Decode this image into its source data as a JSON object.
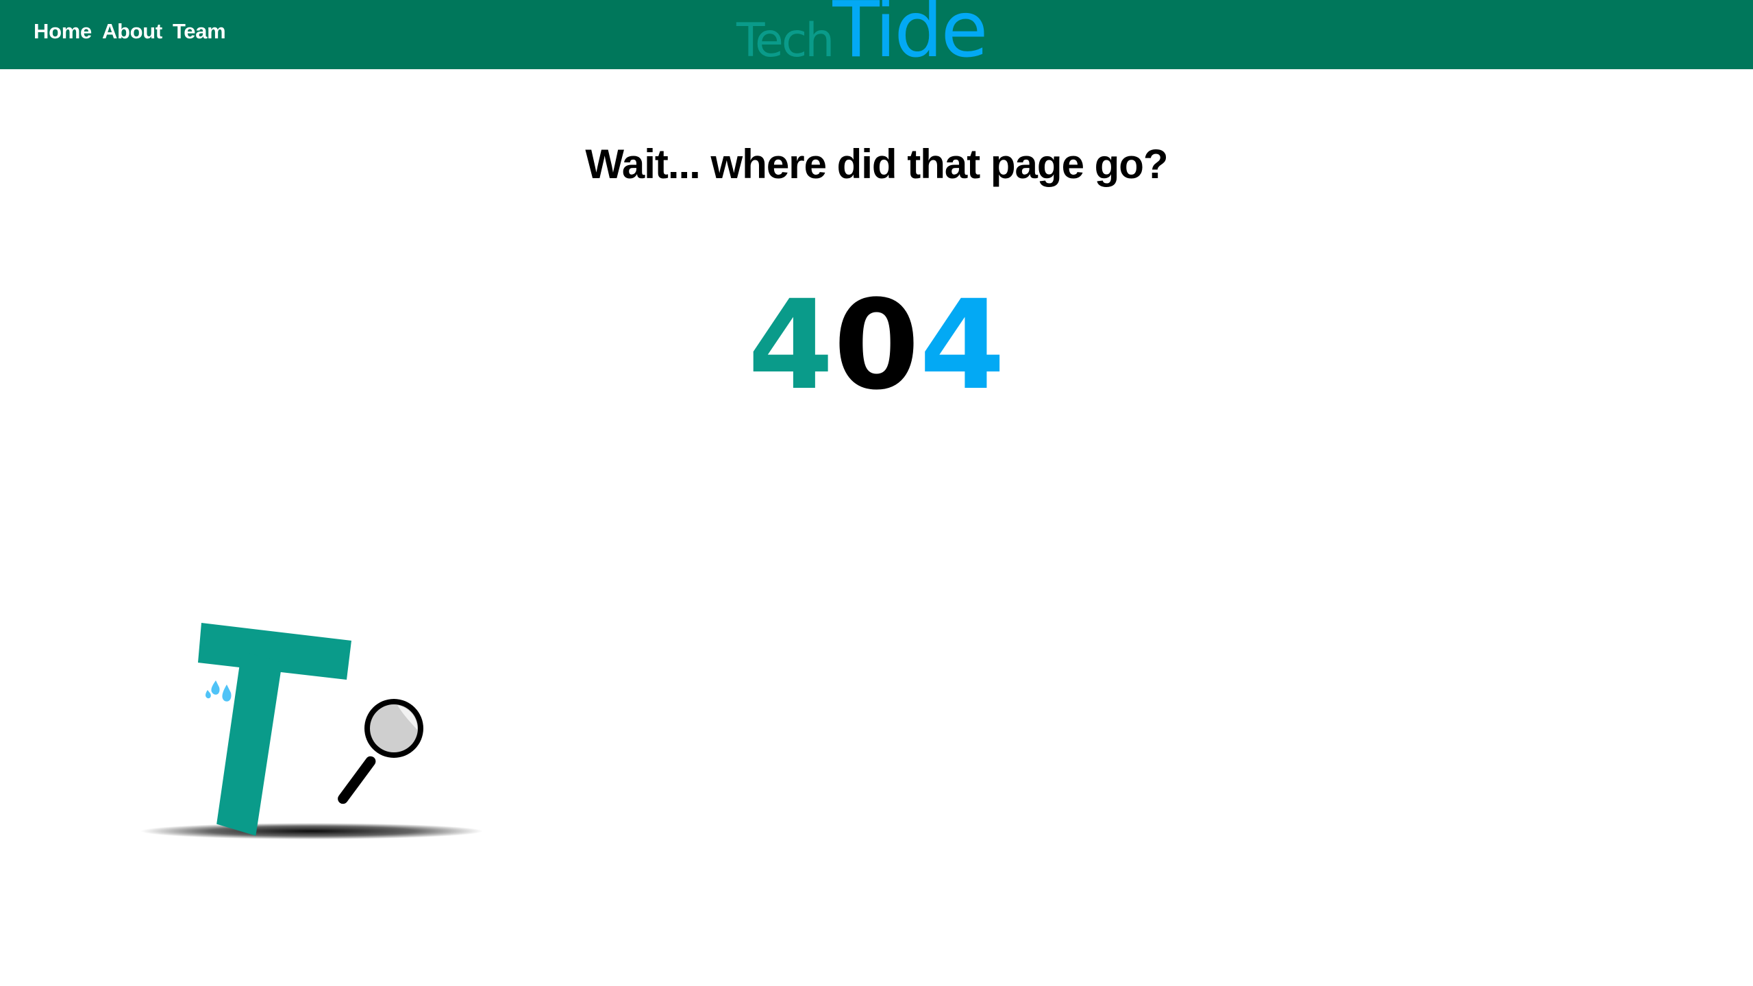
{
  "nav": {
    "links": [
      "Home",
      "About",
      "Team"
    ]
  },
  "logo": {
    "part1": "Tech",
    "part2": "Tide"
  },
  "main": {
    "headline": "Wait... where did that page go?",
    "code_digits": [
      "4",
      "0",
      "4"
    ]
  },
  "colors": {
    "navbar": "#00775b",
    "teal": "#0a9b8a",
    "blue": "#03a9f4",
    "black": "#000000"
  },
  "icons": {
    "mascot": "letter-t-mascot",
    "magnifier": "magnifying-glass-icon",
    "sweat": "sweat-drops-icon"
  }
}
